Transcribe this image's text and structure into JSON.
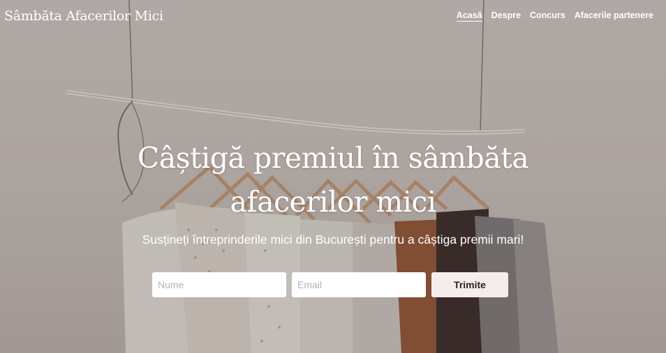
{
  "site": {
    "title": "Sâmbăta Afacerilor Mici"
  },
  "nav": {
    "items": [
      {
        "label": "Acasă",
        "active": true
      },
      {
        "label": "Despre",
        "active": false
      },
      {
        "label": "Concurs",
        "active": false
      },
      {
        "label": "Afacerile partenere",
        "active": false
      }
    ]
  },
  "hero": {
    "headline_line1": "Câștigă premiul în sâmbăta",
    "headline_line2": "afacerilor mici",
    "subheadline": "Susțineți întreprinderile mici din București pentru a câștiga premii mari!"
  },
  "form": {
    "name_placeholder": "Nume",
    "email_placeholder": "Email",
    "submit_label": "Trimite"
  },
  "colors": {
    "text": "#ffffff",
    "button_bg": "#f5ecec",
    "button_text": "#2a2224",
    "placeholder": "#b3b3b3"
  },
  "background": {
    "image": "clothes-rack-photo"
  }
}
